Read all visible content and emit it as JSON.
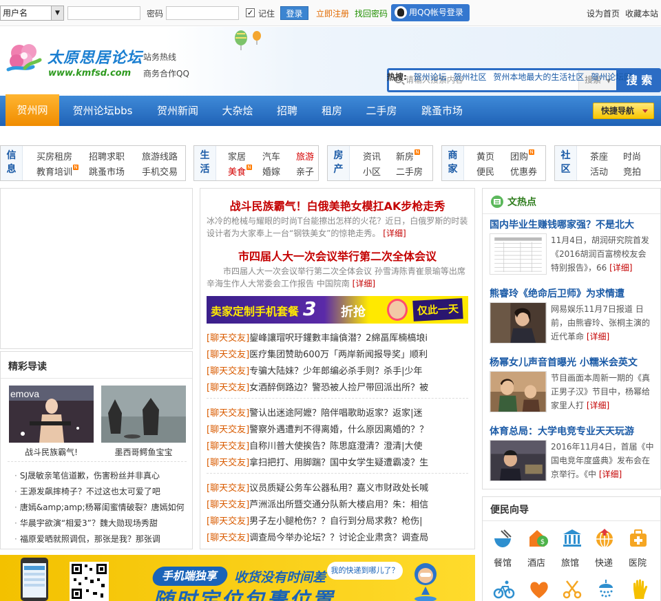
{
  "topbar": {
    "user_select": "用户名",
    "password_label": "密码",
    "remember_label": "记住",
    "login_button": "登录",
    "register_link": "立即注册",
    "recover_link": "找回密码",
    "qq_login": "用QQ帐号登录",
    "set_home": "设为首页",
    "favorite": "收藏本站"
  },
  "header": {
    "logo_title": "太原思居论坛",
    "logo_url": "www.kmfsd.com",
    "hotline": "站务热线",
    "qq_partner": "商务合作QQ",
    "search_placeholder": "请输入搜索内容",
    "search_type": "搜索",
    "search_button": "搜 索",
    "hot_label": "热搜:",
    "hot_links": [
      "贺州论坛",
      "贺州社区",
      "贺州本地最大的生活社区",
      "贺州论坛网"
    ]
  },
  "nav": {
    "items": [
      "贺州网",
      "贺州论坛bbs",
      "贺州新闻",
      "大杂烩",
      "招聘",
      "租房",
      "二手房",
      "跳蚤市场"
    ],
    "quick_nav": "快捷导航"
  },
  "categories": [
    {
      "title": "信息",
      "links": [
        "买房租房",
        "招聘求职",
        "旅游线路",
        "教育培训",
        "跳蚤市场",
        "手机交易"
      ]
    },
    {
      "title": "生活",
      "links": [
        "家居",
        "汽车",
        "旅游",
        "美食",
        "婚嫁",
        "亲子"
      ]
    },
    {
      "title": "房产",
      "links": [
        "资讯",
        "新房",
        "小区",
        "二手房"
      ]
    },
    {
      "title": "商家",
      "links": [
        "黄页",
        "团购",
        "便民",
        "优惠券"
      ]
    },
    {
      "title": "社区",
      "links": [
        "茶座",
        "时尚",
        "活动",
        "竞拍"
      ]
    }
  ],
  "featured": {
    "title": "精彩导读",
    "captions": [
      "战斗民族霸气!",
      "墨西哥鳄鱼宝宝"
    ],
    "list": [
      "SJ晟敏亲笔信道歉，伤害粉丝并非真心",
      "王源发飙摔椅子？不过这也太可爱了吧",
      "唐嫣&amp;amp;杨幂闺蜜情破裂？唐嫣如何",
      "华晨宇欲演“相爱3”？魏大勋现场秀甜",
      "福原爱晒就照调侃，那张是我？那张调"
    ]
  },
  "center": {
    "head1": "战斗民族霸气！白俄美艳女模扛AK步枪走秀",
    "desc1": "冰冷的枪械与耀眼的时尚T台能擦出怎样的火花？近日，白俄罗斯的时装设计者为大家奉上一台“钢铁美女”的惊艳走秀。",
    "head2": "市四届人大一次会议举行第二次全体会议",
    "desc2": "市四届人大一次会议举行第二次全体会议    孙雪涛陈青崔景瑜等出席    辛海生作人大常委会工作报告    中国院南",
    "more": "[详细]",
    "banner": {
      "t1": "卖家定制手机套餐",
      "t2": "3",
      "t3": "折抢",
      "t4": "仅此一天"
    },
    "chat_tag": "[聊天交友]",
    "chat_groups": [
      [
        "鋆峰讓瑁呎玗鑵數丰鑰僋潜？2綿畐厍楠槁埌i",
        "医疗集团赞助600万「两岸新闻报导奖」顺利",
        "专骗大陆妹？少年郎编必杀手则？杀手|少年",
        "女酒醉倒路边？警恐被人捡尸带回派出所？被"
      ],
      [
        "警认出迷途阿嬷？陪伴唱歌助返家？返家|迷",
        "警察外遇遭判不得离婚，什么原因离婚的？？",
        "自称川普大使挨告？陈思庭澄清？澄清|大使",
        "拿扫把打、用脚踹？国中女学生疑遭霸凌？生"
      ],
      [
        "议员质疑公务车公器私用？嘉义市财政处长喊",
        "芦洲派出所暨交通分队新大楼启用？朱：相信",
        "男子左小腿枪伤？？自行到分局求救？枪伤|",
        "调查局今举办论坛？？讨论企业肃贪？调查局"
      ]
    ]
  },
  "hotnews": {
    "title": "文热点",
    "items": [
      {
        "title": "国内毕业生赚钱哪家强？不是北大",
        "desc": "11月4日，胡润研究院首发《2016胡润百富榜校友会特别报告》，66",
        "more": "[详细]"
      },
      {
        "title": "熊睿玲《绝命后卫师》为求情遭",
        "desc": "网易娱乐11月7日报道 日前，由熊睿玲、张桐主演的近代革命",
        "more": "[详细]"
      },
      {
        "title": "杨幂女儿声音首曝光 小糯米会英文",
        "desc": "节目画面本周新一期的《真正男子汉》节目中，杨幂给家里人打",
        "more": "[详细]"
      },
      {
        "title": "体育总局：大学电竞专业天天玩游",
        "desc": "2016年11月4日，首届《中国电竞年度盛典》发布会在京举行。《中",
        "more": "[详细]"
      }
    ]
  },
  "services": {
    "title": "便民向导",
    "items": [
      "餐馆",
      "酒店",
      "旅馆",
      "快递",
      "医院"
    ]
  },
  "bottom_banner": {
    "text1": "手机端独享",
    "text2": "收货没有时间差",
    "text3": "随时定位包裹位置",
    "bubble": "我的快递到哪儿了？"
  }
}
